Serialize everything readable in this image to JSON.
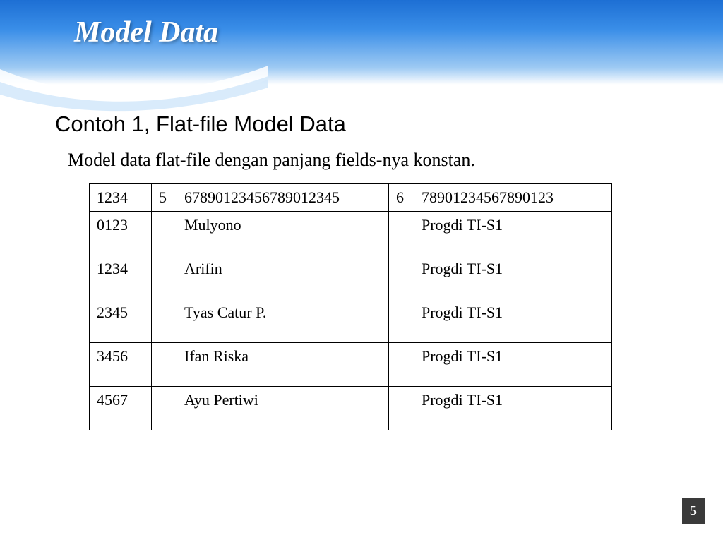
{
  "header": {
    "title": "Model Data"
  },
  "subtitle": "Contoh 1, Flat-file Model Data",
  "description": "Model data flat-file dengan panjang fields-nya konstan.",
  "table": {
    "header_row": [
      "1234",
      "5",
      "67890123456789012345",
      "6",
      "78901234567890123"
    ],
    "rows": [
      [
        "0123",
        "",
        "Mulyono",
        "",
        "Progdi TI-S1"
      ],
      [
        "1234",
        "",
        "Arifin",
        "",
        "Progdi TI-S1"
      ],
      [
        "2345",
        "",
        "Tyas Catur P.",
        "",
        "Progdi TI-S1"
      ],
      [
        "3456",
        "",
        "Ifan Riska",
        "",
        "Progdi TI-S1"
      ],
      [
        "4567",
        "",
        "Ayu Pertiwi",
        "",
        "Progdi TI-S1"
      ]
    ]
  },
  "page_number": "5"
}
